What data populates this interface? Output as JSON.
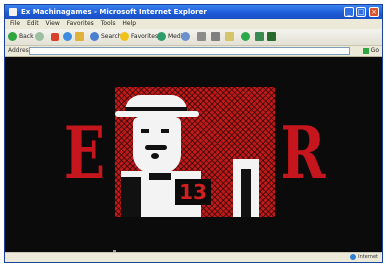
{
  "window": {
    "title": "Ex Machinagames - Microsoft Internet Explorer",
    "buttons": {
      "minimize": "_",
      "maximize": "□",
      "close": "×"
    }
  },
  "menubar": {
    "items": [
      "File",
      "Edit",
      "View",
      "Favorites",
      "Tools",
      "Help"
    ]
  },
  "toolbar": {
    "back_label": "Back",
    "search_label": "Search",
    "favorites_label": "Favorites",
    "media_label": "Media",
    "icons": [
      "back-icon",
      "forward-icon",
      "stop-icon",
      "refresh-icon",
      "home-icon",
      "search-icon",
      "favorites-icon",
      "media-icon",
      "history-icon",
      "mail-icon",
      "print-icon",
      "edit-icon",
      "discuss-icon",
      "messenger-icon",
      "extra-icon"
    ]
  },
  "addressbar": {
    "label": "Address",
    "url": "",
    "go_label": "Go"
  },
  "page": {
    "header_text": "",
    "letters": {
      "left": "E",
      "right": "R"
    },
    "badge": "13",
    "credits_line1": "",
    "credits_link": "",
    "credits_line2": ""
  },
  "statusbar": {
    "text": "",
    "zone": "Internet"
  },
  "colors": {
    "accent_red": "#c4161c",
    "page_background": "#0b0b0b",
    "titlebar_blue": "#1c5ad6"
  }
}
